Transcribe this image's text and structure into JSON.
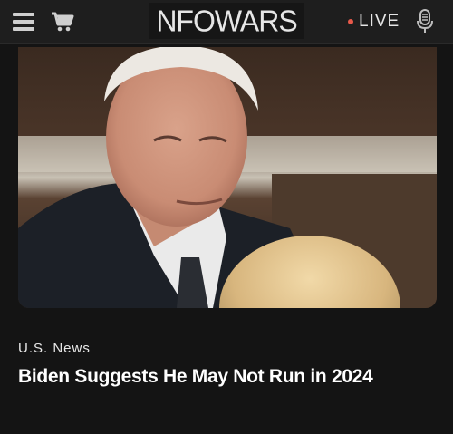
{
  "header": {
    "logo_text": "NFOWARS",
    "live_label": "LIVE",
    "menu_icon": "hamburger-menu-icon",
    "cart_icon": "shopping-cart-icon",
    "mic_icon": "microphone-icon",
    "live_dot_color": "#e8594a"
  },
  "article": {
    "category": "U.S. News",
    "headline": "Biden Suggests He May Not Run in 2024"
  },
  "colors": {
    "background": "#141414",
    "topbar": "#1e1e1e"
  }
}
